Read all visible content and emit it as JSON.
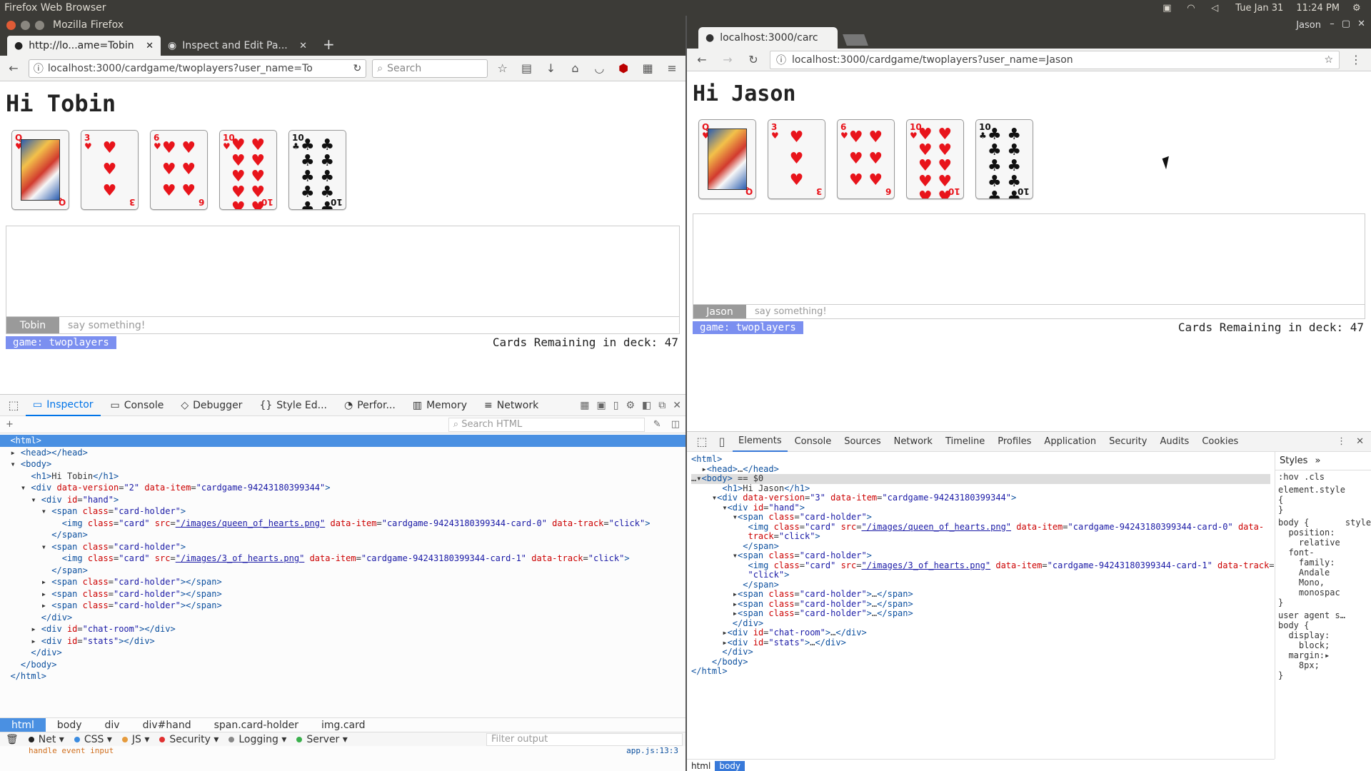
{
  "topbar": {
    "title": "Firefox Web Browser",
    "date": "Tue Jan 31",
    "time": "11:24 PM"
  },
  "firefox": {
    "window_title": "Mozilla Firefox",
    "tabs": [
      {
        "label": "http://lo...ame=Tobin"
      },
      {
        "label": "Inspect and Edit Pa..."
      }
    ],
    "url": "localhost:3000/cardgame/twoplayers?user_name=To",
    "search_placeholder": "Search",
    "page": {
      "heading": "Hi Tobin",
      "chat_name": "Tobin",
      "chat_placeholder": "say something!",
      "game_badge": "game: twoplayers",
      "cards_remaining": "Cards Remaining in deck: 47"
    },
    "devtools": {
      "tabs": [
        "Inspector",
        "Console",
        "Debugger",
        "Style Ed...",
        "Perfor...",
        "Memory",
        "Network"
      ],
      "search_placeholder": "Search HTML",
      "breadcrumbs": [
        "html",
        "body",
        "div",
        "div#hand",
        "span.card-holder",
        "img.card"
      ],
      "console_filters": [
        "Net",
        "CSS",
        "JS",
        "Security",
        "Logging",
        "Server"
      ],
      "filter_placeholder": "Filter output",
      "console_message": "handle event input",
      "console_source": "app.js:13:3"
    }
  },
  "cards": [
    {
      "rank": "Q",
      "suit": "♥",
      "color": "red",
      "pips": 0,
      "face": true
    },
    {
      "rank": "3",
      "suit": "♥",
      "color": "red",
      "pips": 3
    },
    {
      "rank": "6",
      "suit": "♥",
      "color": "red",
      "pips": 6
    },
    {
      "rank": "10",
      "suit": "♥",
      "color": "red",
      "pips": 10
    },
    {
      "rank": "10",
      "suit": "♣",
      "color": "black",
      "pips": 10
    }
  ],
  "chrome": {
    "tab_label": "localhost:3000/carc",
    "user": "Jason",
    "url": "localhost:3000/cardgame/twoplayers?user_name=Jason",
    "page": {
      "heading": "Hi Jason",
      "chat_name": "Jason",
      "chat_placeholder": "say something!",
      "game_badge": "game: twoplayers",
      "cards_remaining": "Cards Remaining in deck: 47"
    },
    "devtools": {
      "tabs": [
        "Elements",
        "Console",
        "Sources",
        "Network",
        "Timeline",
        "Profiles",
        "Application",
        "Security",
        "Audits",
        "Cookies"
      ],
      "styles_tab": "Styles",
      "styles_filters": ":hov .cls",
      "breadcrumbs": [
        "html",
        "body"
      ]
    }
  }
}
